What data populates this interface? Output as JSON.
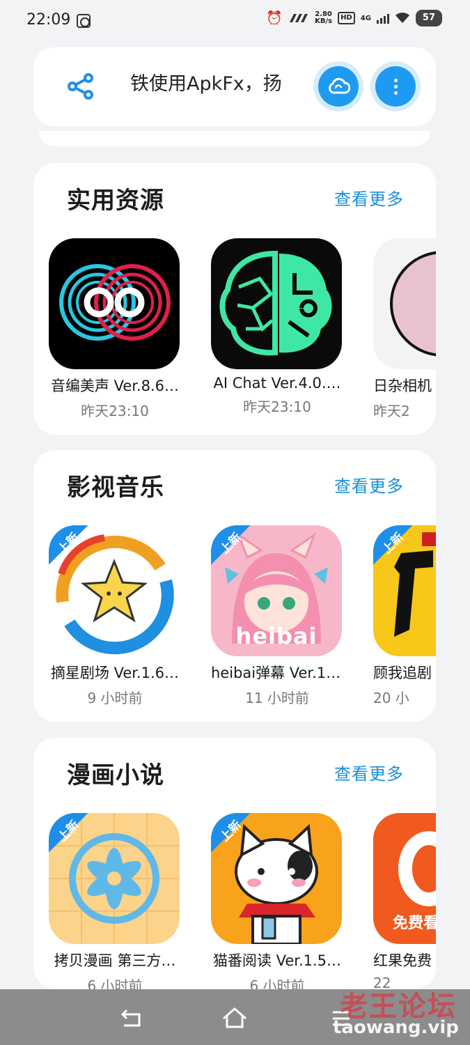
{
  "status_bar": {
    "time": "22:09",
    "speed_value": "2.80",
    "speed_unit": "KB/s",
    "hd_label": "HD",
    "network_label": "4G",
    "battery": "57",
    "icons": [
      "gallery-icon",
      "alarm-icon",
      "signal-icon",
      "wifi-icon"
    ]
  },
  "top_bar": {
    "marquee_text": "务铁使用ApkFx，扬",
    "icons": [
      "share-icon",
      "cloud-sync-icon",
      "more-vertical-icon"
    ],
    "accent_color": "#1e9bf0"
  },
  "sections": [
    {
      "title": "实用资源",
      "more_label": "查看更多",
      "apps": [
        {
          "name": "音编美声 Ver.8.6…",
          "time": "昨天23:10",
          "badge": ""
        },
        {
          "name": "AI Chat Ver.4.0.…",
          "time": "昨天23:10",
          "badge": ""
        },
        {
          "name": "日杂相机",
          "time": "昨天2",
          "badge": ""
        }
      ]
    },
    {
      "title": "影视音乐",
      "more_label": "查看更多",
      "apps": [
        {
          "name": "摘星剧场 Ver.1.6…",
          "time": "9 小时前",
          "badge": "上新"
        },
        {
          "name": "heibai弹幕 Ver.1.…",
          "time": "11 小时前",
          "badge": "上新",
          "icon_text": "heibai"
        },
        {
          "name": "顾我追剧",
          "time": "20 小",
          "badge": "上新"
        }
      ]
    },
    {
      "title": "漫画小说",
      "more_label": "查看更多",
      "apps": [
        {
          "name": "拷贝漫画 第三方…",
          "time": "6 小时前",
          "badge": "上新"
        },
        {
          "name": "猫番阅读 Ver.1.5…",
          "time": "6 小时前",
          "badge": "上新"
        },
        {
          "name": "红果免费",
          "time": "22 ",
          "badge": "",
          "icon_text": "免费看"
        }
      ]
    }
  ],
  "nav_bar": {
    "icons": [
      "back-icon",
      "home-icon",
      "menu-icon"
    ]
  },
  "watermark": {
    "title": "老王论坛",
    "url": "taowang.vip"
  }
}
